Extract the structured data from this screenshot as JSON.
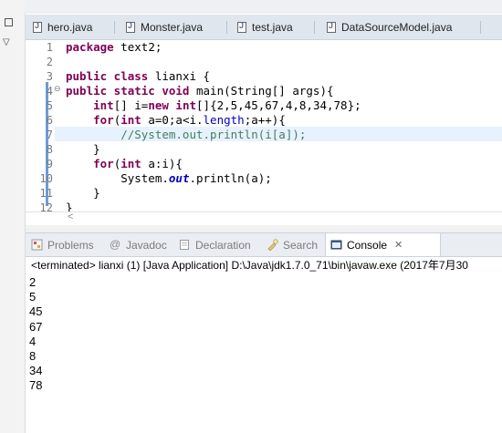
{
  "editor_tabs": [
    {
      "label": "hero.java",
      "active": false
    },
    {
      "label": "Monster.java",
      "active": false
    },
    {
      "label": "test.java",
      "active": false
    },
    {
      "label": "DataSourceModel.java",
      "active": false
    }
  ],
  "code": {
    "line_numbers": [
      "1",
      "2",
      "3",
      "4",
      "5",
      "6",
      "7",
      "8",
      "9",
      "10",
      "11",
      "12"
    ],
    "highlighted_line": "7"
  },
  "view_tabs": [
    {
      "label": "Problems",
      "icon": "problems-icon"
    },
    {
      "label": "Javadoc",
      "icon": "at-icon"
    },
    {
      "label": "Declaration",
      "icon": "declaration-icon"
    },
    {
      "label": "Search",
      "icon": "flashlight-icon"
    },
    {
      "label": "Console",
      "icon": "console-icon",
      "active": true
    }
  ],
  "console": {
    "header": "<terminated> lianxi (1) [Java Application] D:\\Java\\jdk1.7.0_71\\bin\\javaw.exe (2017年7月30",
    "output": [
      "2",
      "5",
      "45",
      "67",
      "4",
      "8",
      "34",
      "78"
    ]
  },
  "colors": {
    "keyword": "#7f0055",
    "comment": "#3f7f5f",
    "field": "#0000c0",
    "line_highlight": "#e8f2fe",
    "tab_bar": "#dfe6ee"
  }
}
